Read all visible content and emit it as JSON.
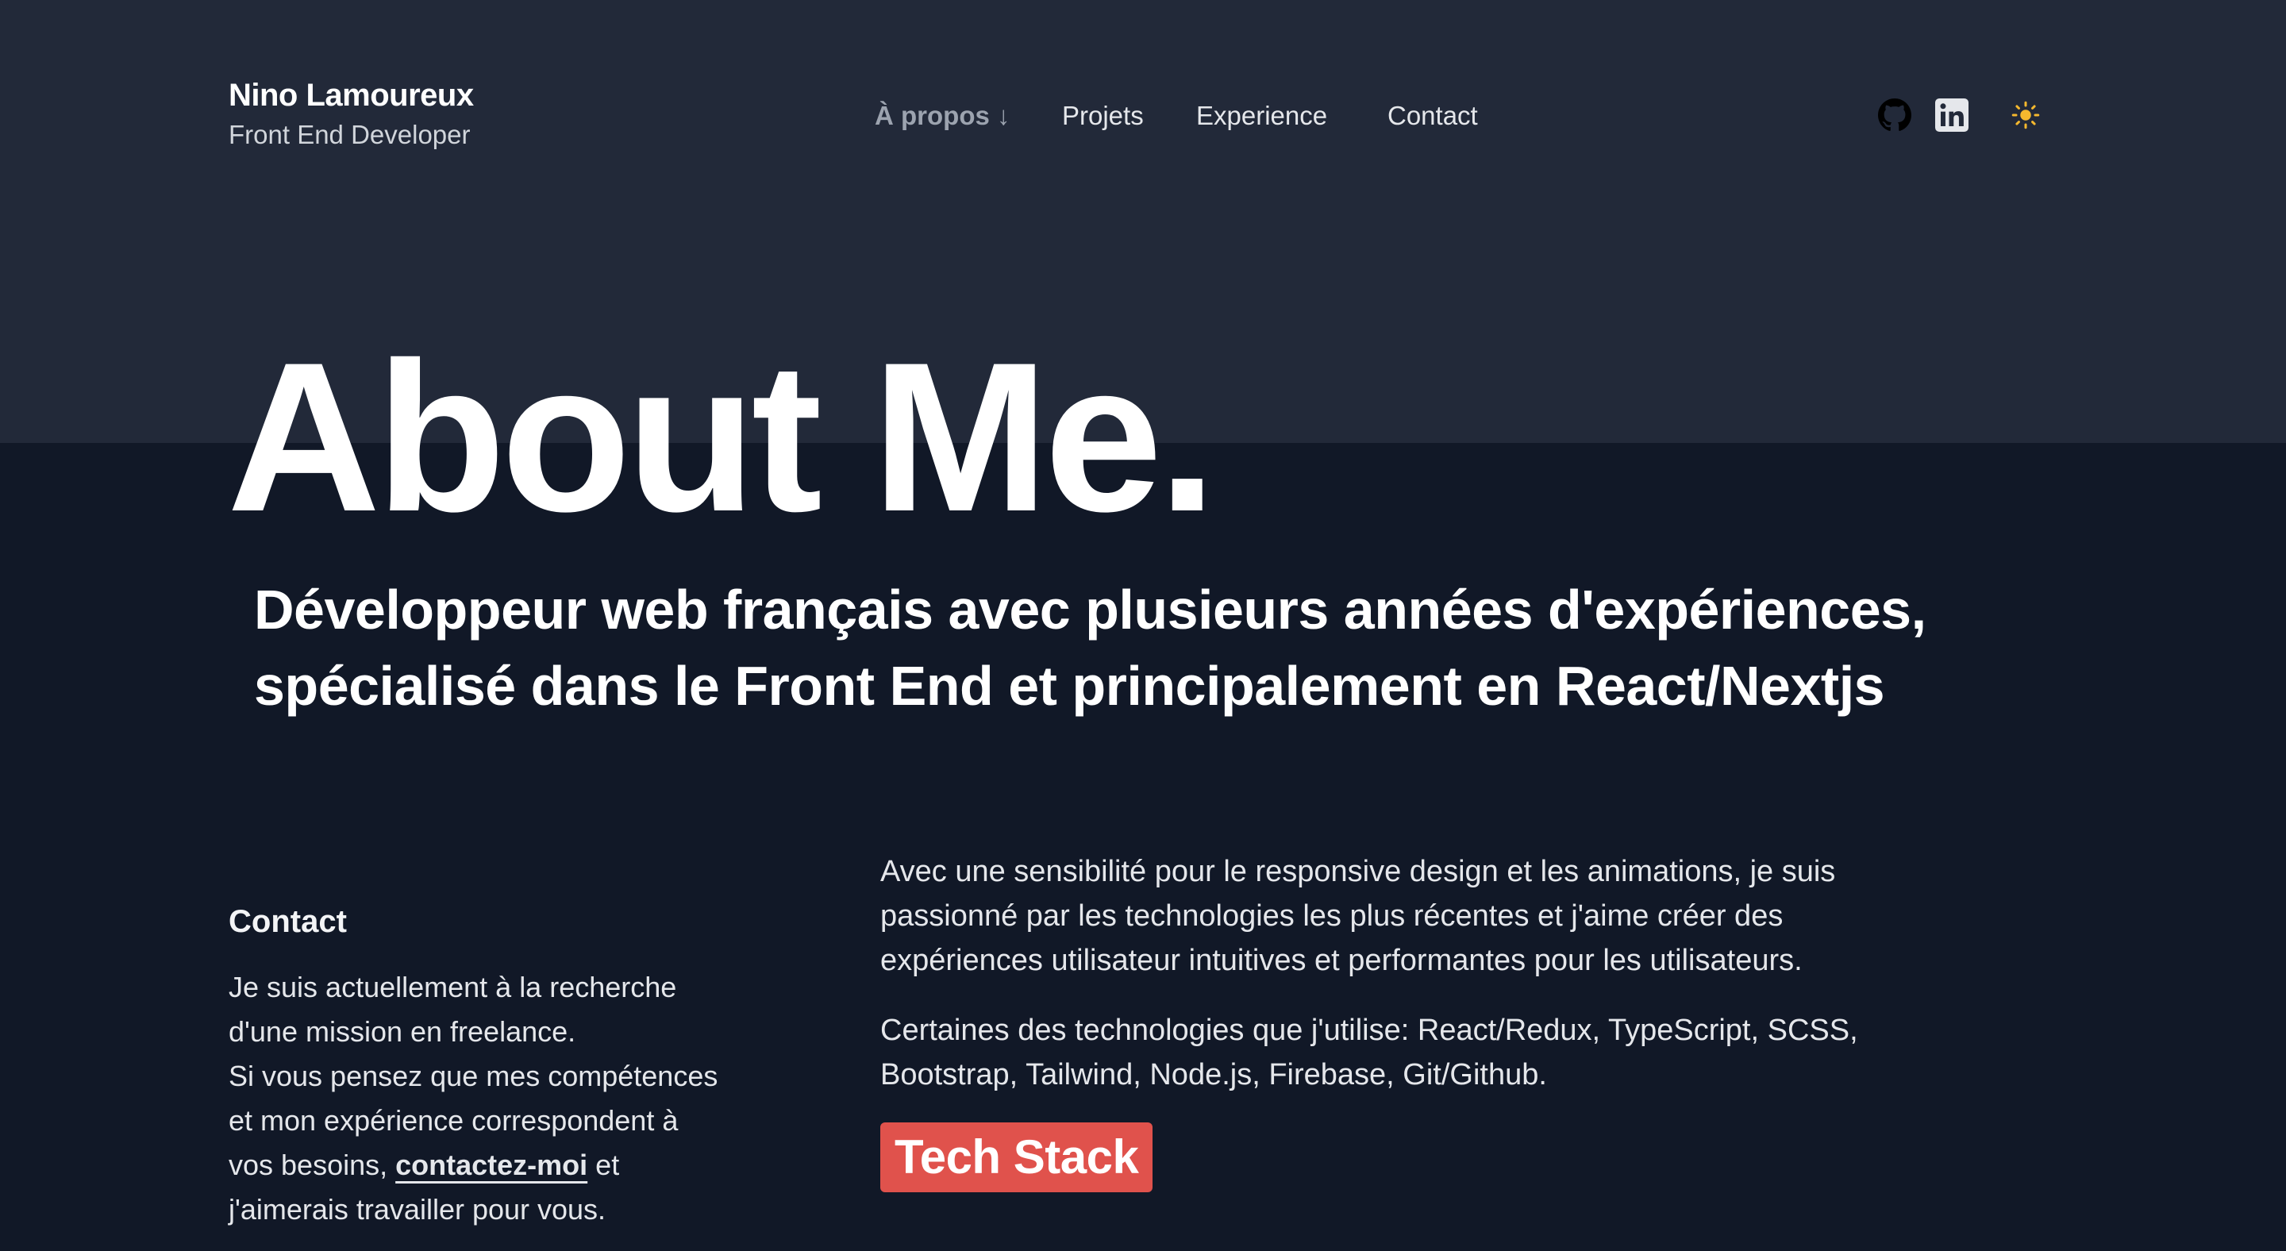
{
  "brand": {
    "name": "Nino Lamoureux",
    "role": "Front End Developer"
  },
  "nav": {
    "about": "À propos ↓",
    "projects": "Projets",
    "experience": "Experience",
    "contact": "Contact"
  },
  "icons": {
    "github": "github-icon",
    "linkedin": "linkedin-icon",
    "theme": "sun-icon"
  },
  "colors": {
    "background": "#111827",
    "header_band": "#222939",
    "accent": "#e0524c",
    "sun": "#f5b82e"
  },
  "hero": {
    "title": "About Me.",
    "tagline_lines": [
      "Développeur web français avec plusieurs années d'expériences,",
      "spécialisé dans le Front End et principalement en React/Nextjs"
    ]
  },
  "contact": {
    "heading": "Contact",
    "lines": [
      "Je suis actuellement à la recherche",
      "d'une mission en freelance.",
      "Si vous pensez que mes compétences",
      "et mon expérience correspondent à"
    ],
    "line_before_link": "vos besoins, ",
    "link_label": "contactez-moi",
    "line_after_link": " et",
    "last_line": "j'aimerais travailler pour vous."
  },
  "about": {
    "paragraph1": [
      "Avec une sensibilité pour le responsive design et les animations, je suis",
      "passionné par les technologies les plus récentes et j'aime créer des",
      "expériences utilisateur intuitives et performantes pour les utilisateurs."
    ],
    "paragraph2": [
      "Certaines des technologies que j'utilise: React/Redux, TypeScript, SCSS,",
      "Bootstrap, Tailwind, Node.js, Firebase, Git/Github."
    ],
    "tech_stack_button": "Tech Stack"
  }
}
